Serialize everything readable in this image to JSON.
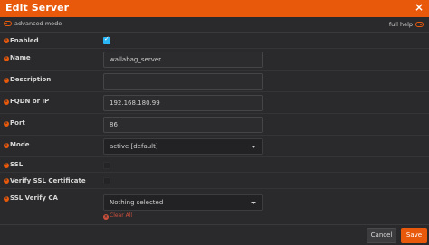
{
  "dialog": {
    "title": "Edit Server",
    "close_label": "×"
  },
  "modebar": {
    "advanced_mode_label": "advanced mode",
    "full_help_label": "full help"
  },
  "fields": {
    "enabled": {
      "label": "Enabled",
      "checked": true
    },
    "name": {
      "label": "Name",
      "value": "wallabag_server"
    },
    "description": {
      "label": "Description",
      "value": ""
    },
    "fqdn": {
      "label": "FQDN or IP",
      "value": "192.168.180.99"
    },
    "port": {
      "label": "Port",
      "value": "86"
    },
    "mode": {
      "label": "Mode",
      "value": "active [default]"
    },
    "ssl": {
      "label": "SSL",
      "checked": false
    },
    "ssl_verify_cert": {
      "label": "Verify SSL Certificate",
      "checked": false
    },
    "ssl_verify_ca": {
      "label": "SSL Verify CA",
      "value": "Nothing selected",
      "clear_all_label": "Clear All"
    }
  },
  "footer": {
    "cancel_label": "Cancel",
    "save_label": "Save"
  },
  "colors": {
    "accent": "#e8590c",
    "checkbox_on": "#29b6f6",
    "background": "#2a2a2c"
  }
}
